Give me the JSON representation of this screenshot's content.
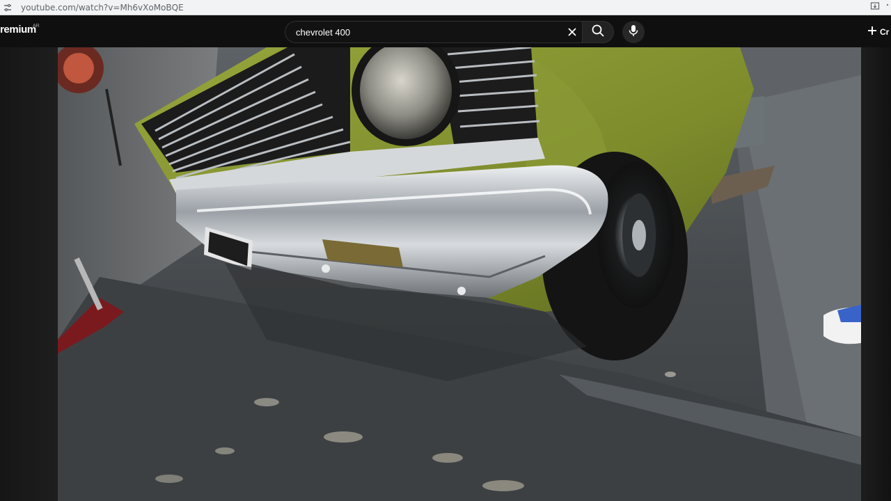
{
  "browser": {
    "url": "youtube.com/watch?v=Mh6vXoMoBQE",
    "icons": {
      "site_settings": "tune-icon",
      "install": "install-app-icon"
    }
  },
  "header": {
    "logo_text": "remium",
    "logo_region": "AR",
    "search": {
      "query": "chevrolet 400",
      "clear_icon": "close-icon",
      "search_icon": "search-icon"
    },
    "mic_icon": "mic-icon",
    "create_label": "Cr",
    "create_icon": "plus-icon"
  },
  "player": {
    "scene": "Close-up of the chrome front bumper and grille of a green Chevrolet 400 in a garage",
    "colors": {
      "car_body": "#7c8a2e",
      "floor": "#4a4e52",
      "chrome": "#c9cdd1"
    }
  }
}
